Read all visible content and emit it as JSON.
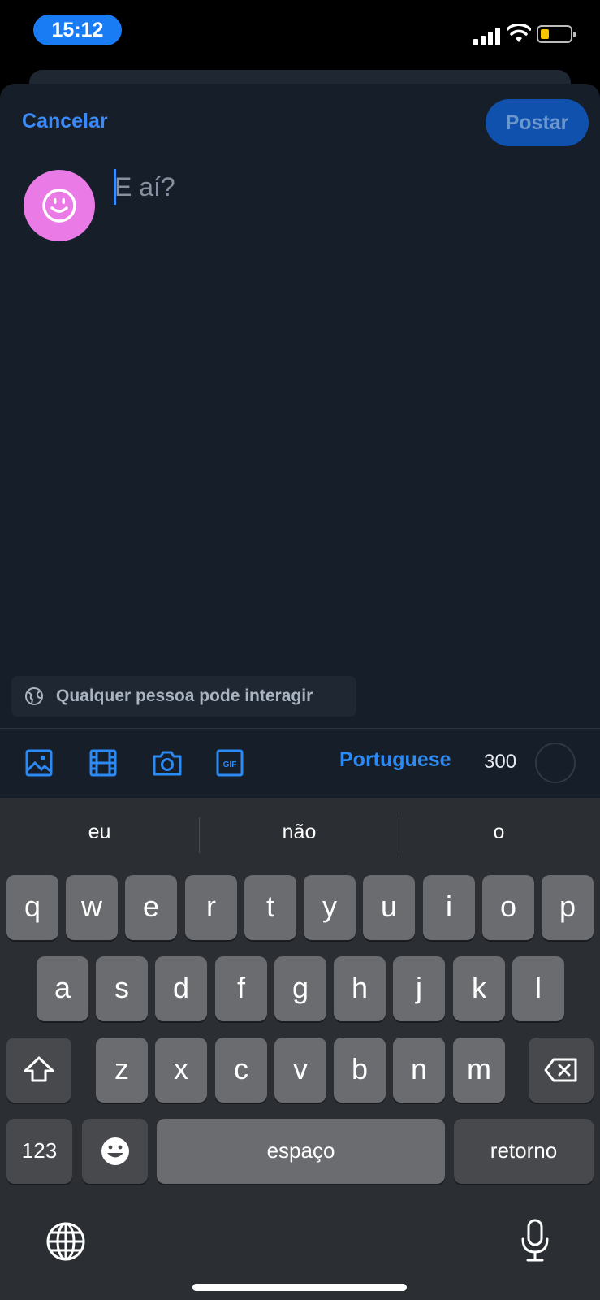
{
  "status": {
    "time": "15:12"
  },
  "composer": {
    "cancel_label": "Cancelar",
    "post_label": "Postar",
    "placeholder": "E aí?",
    "reply_setting": "Qualquer pessoa pode interagir",
    "language": "Portuguese",
    "char_count": "300"
  },
  "toolbar": {
    "icons": [
      "image-icon",
      "video-icon",
      "camera-icon",
      "gif-icon"
    ],
    "gif_text": "GIF"
  },
  "keyboard": {
    "suggestions": [
      "eu",
      "não",
      "o"
    ],
    "row1": [
      "q",
      "w",
      "e",
      "r",
      "t",
      "y",
      "u",
      "i",
      "o",
      "p"
    ],
    "row2": [
      "a",
      "s",
      "d",
      "f",
      "g",
      "h",
      "j",
      "k",
      "l"
    ],
    "row3": [
      "z",
      "x",
      "c",
      "v",
      "b",
      "n",
      "m"
    ],
    "numbers_label": "123",
    "space_label": "espaço",
    "return_label": "retorno"
  },
  "colors": {
    "accent": "#3a8af7",
    "post_button": "#1051ad",
    "avatar": "#ea7ae6",
    "sheet_bg": "#161e29",
    "keyboard_bg": "#2b2f34"
  }
}
